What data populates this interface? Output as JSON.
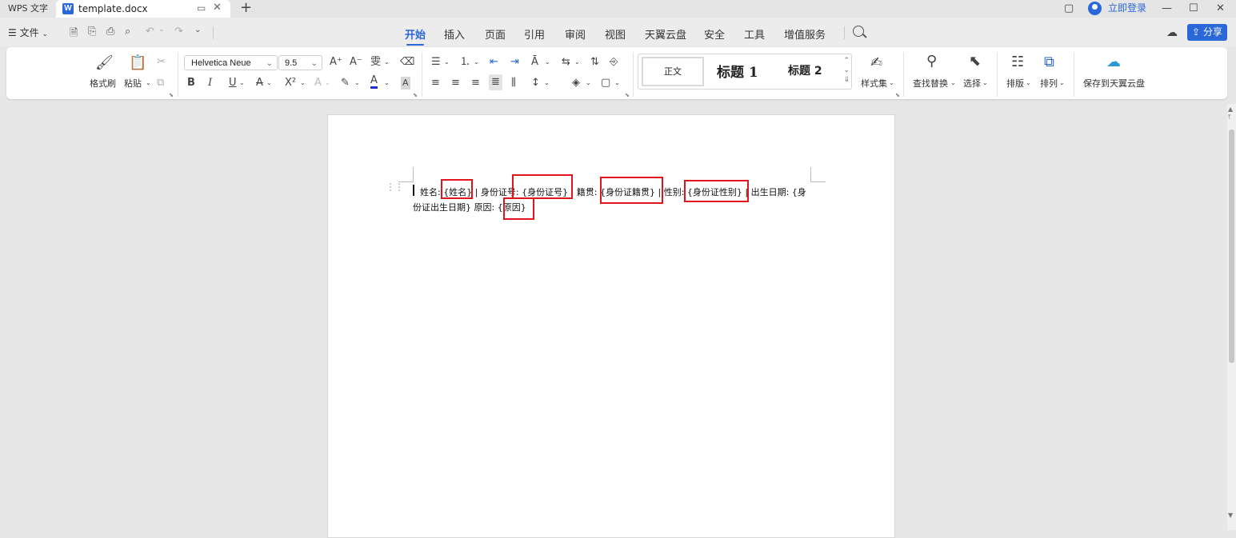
{
  "titlebar": {
    "app_label": "WPS 文字",
    "doc_name": "template.docx",
    "login_label": "立即登录",
    "icons": {
      "monitor": "monitor-icon",
      "close": "close-icon",
      "add": "plus-icon"
    }
  },
  "menubar": {
    "file_label": "文件",
    "tabs": [
      "开始",
      "插入",
      "页面",
      "引用",
      "审阅",
      "视图",
      "天翼云盘",
      "安全",
      "工具",
      "增值服务"
    ],
    "active_tab": "开始",
    "share_label": "分享"
  },
  "ribbon": {
    "format_painter": "格式刷",
    "paste": "粘贴",
    "font_name": "Helvetica Neue",
    "font_size": "9.5",
    "style_normal": "正文",
    "style_h1": "标题 1",
    "style_h2": "标题 2",
    "style_set": "样式集",
    "find_replace": "查找替换",
    "select": "选择",
    "layout": "排版",
    "arrange": "排列",
    "save_cloud": "保存到天翼云盘",
    "bold": "B",
    "italic": "I",
    "underline": "U",
    "superscript": "X²"
  },
  "document": {
    "line1": "姓名: {姓名} | 身份证号: {身份证号} | 籍贯: {身份证籍贯} | 性别: {身份证性别} | 出生日期: {身",
    "line2": "份证出生日期}   原因: {原因}"
  },
  "colors": {
    "accent": "#2a67d8",
    "highlight": "#e0141a",
    "font_color": "#1f2fd6"
  }
}
